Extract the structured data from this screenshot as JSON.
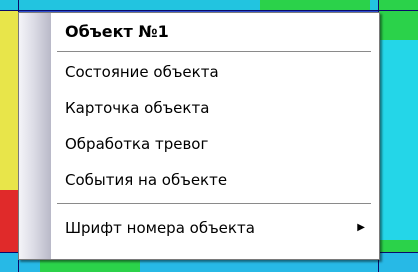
{
  "context_menu": {
    "header": "Объект №1",
    "items": [
      {
        "label": "Состояние объекта"
      },
      {
        "label": "Карточка объекта"
      },
      {
        "label": "Обработка тревог"
      },
      {
        "label": "События на объекте"
      }
    ],
    "submenu_item": {
      "label": "Шрифт номера объекта",
      "arrow": "▶"
    }
  },
  "background": {
    "colors": {
      "grid_blue": "#2f4fd0",
      "green": "#2bd24a",
      "cyan": "#24d6e8",
      "yellow": "#e8e54a",
      "red": "#e02a2a"
    }
  }
}
